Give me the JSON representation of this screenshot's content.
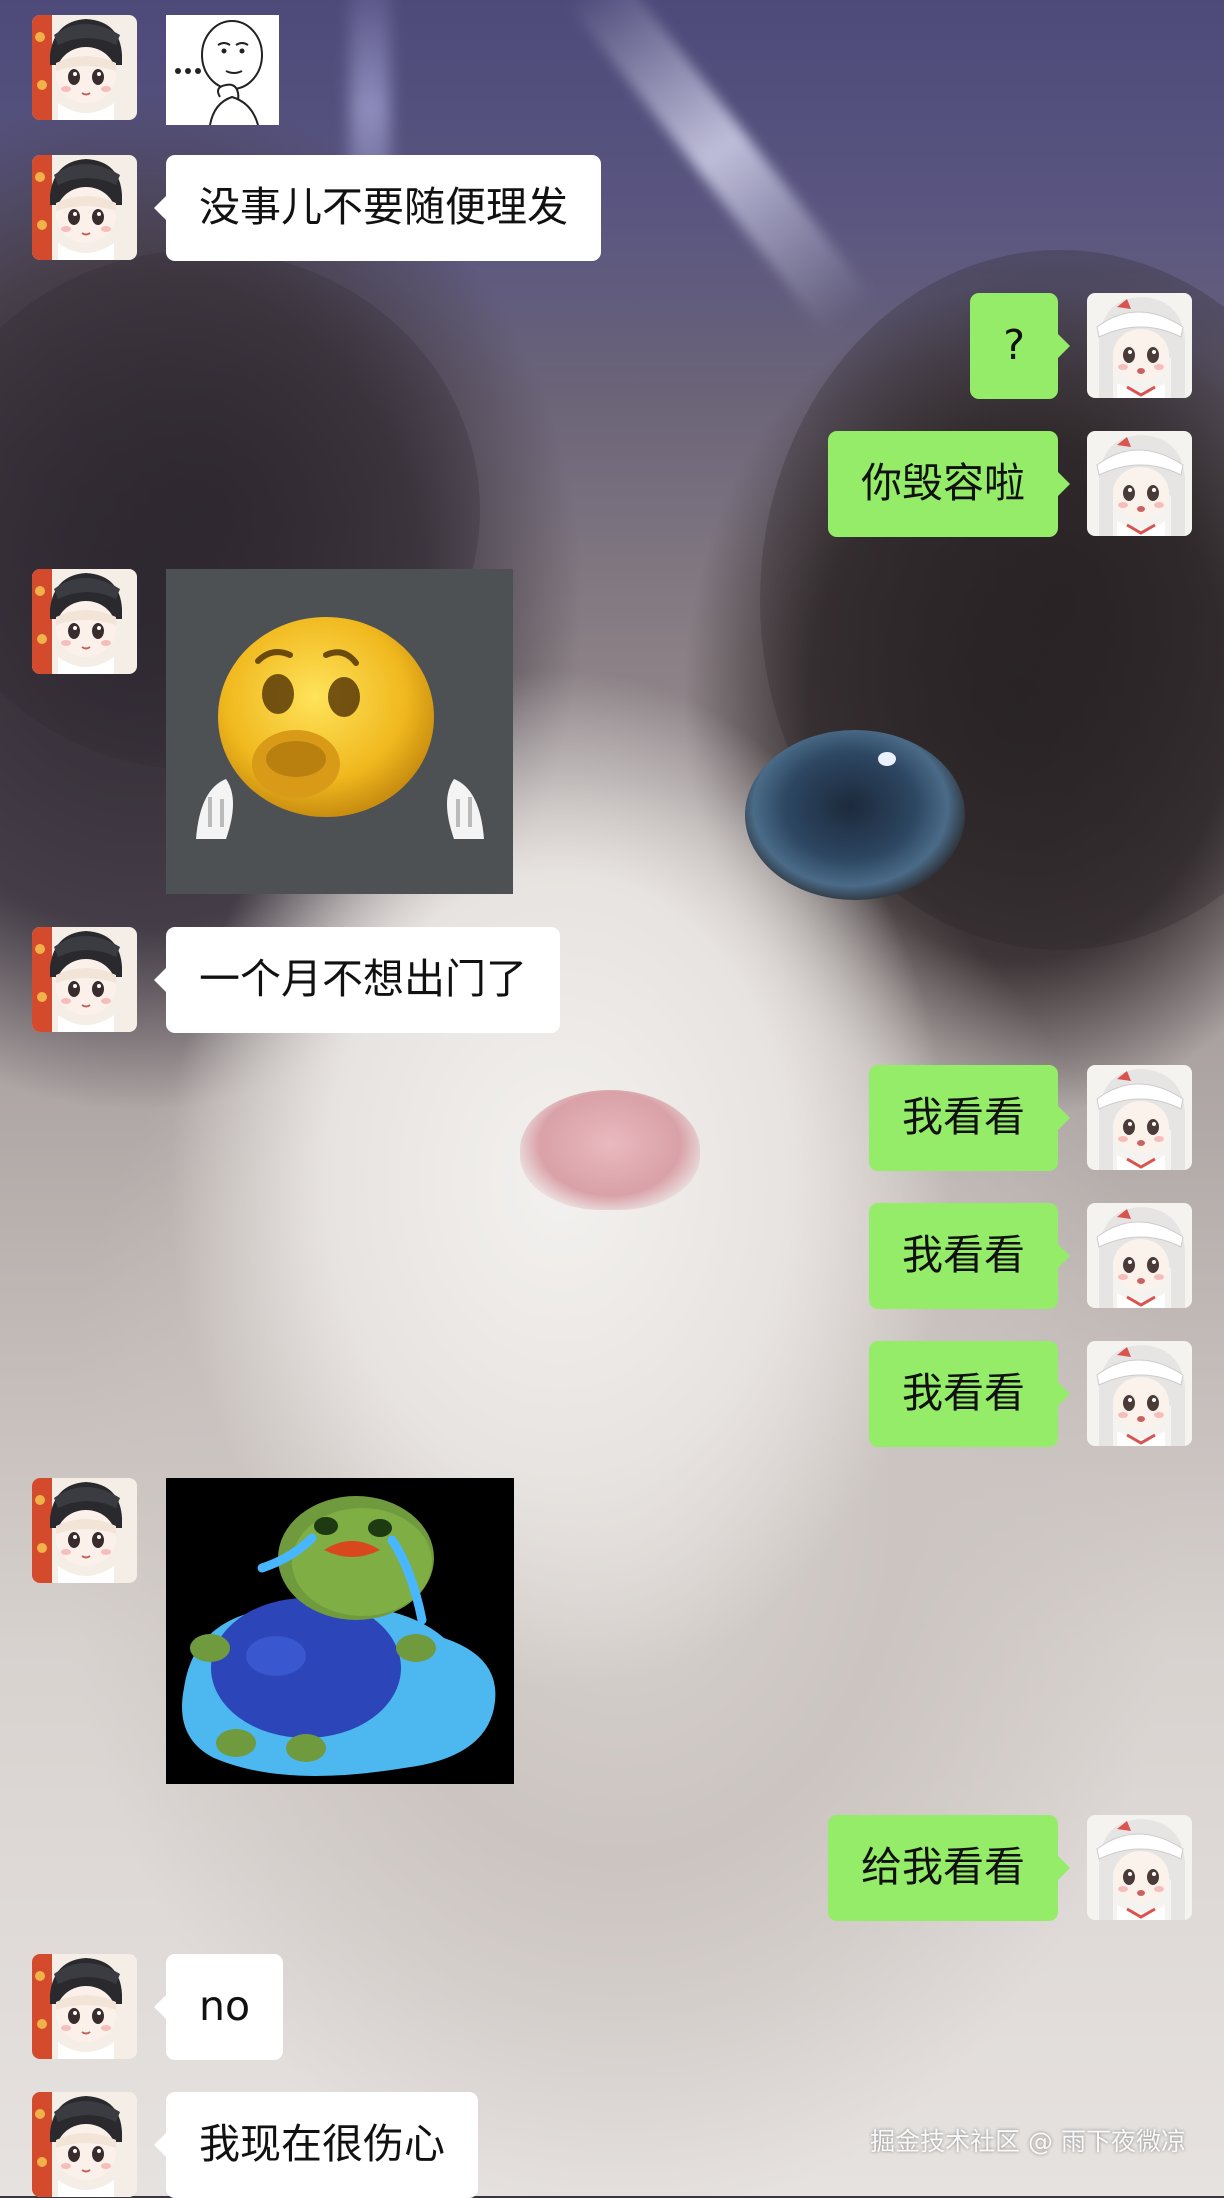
{
  "messages": [
    {
      "side": "left",
      "kind": "sticker",
      "sticker": "thinking-face-meme"
    },
    {
      "side": "left",
      "kind": "text",
      "text": "没事儿不要随便理发"
    },
    {
      "side": "right",
      "kind": "text",
      "text": "?"
    },
    {
      "side": "right",
      "kind": "text",
      "text": "你毁容啦"
    },
    {
      "side": "left",
      "kind": "sticker",
      "sticker": "sad-yellow-emoji"
    },
    {
      "side": "left",
      "kind": "text",
      "text": "一个月不想出门了"
    },
    {
      "side": "right",
      "kind": "text",
      "text": "我看看"
    },
    {
      "side": "right",
      "kind": "text",
      "text": "我看看"
    },
    {
      "side": "right",
      "kind": "text",
      "text": "我看看"
    },
    {
      "side": "left",
      "kind": "sticker",
      "sticker": "crying-frog"
    },
    {
      "side": "right",
      "kind": "text",
      "text": "给我看看"
    },
    {
      "side": "left",
      "kind": "text",
      "text": "no"
    },
    {
      "side": "left",
      "kind": "text",
      "text": "我现在很伤心"
    }
  ],
  "watermark": "掘金技术社区 @ 雨下夜微凉",
  "colors": {
    "outgoing_bubble": "#95ec69",
    "incoming_bubble": "#ffffff"
  }
}
